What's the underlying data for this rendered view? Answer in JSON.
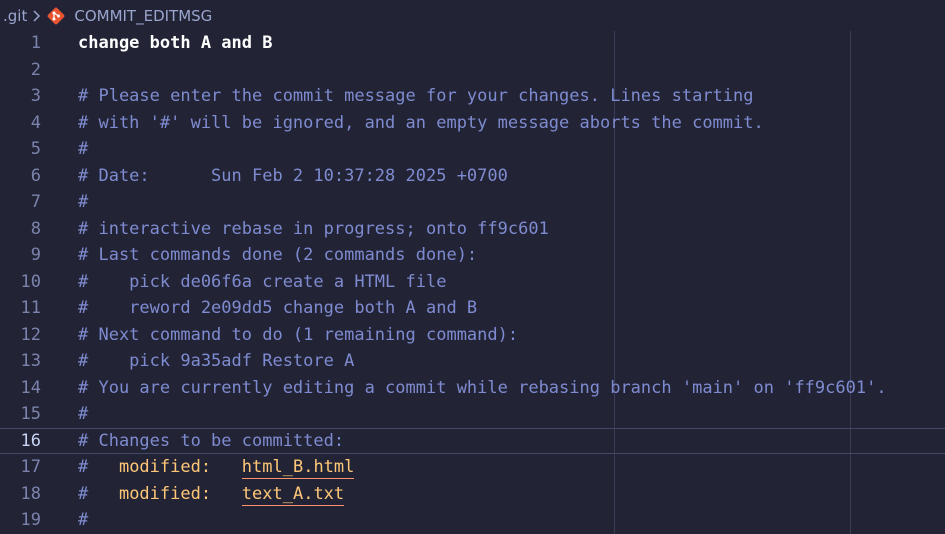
{
  "breadcrumb": {
    "folder": ".git",
    "file": "COMMIT_EDITMSG",
    "file_icon": "git-icon",
    "separator_icon": "chevron-right-icon"
  },
  "colors": {
    "background": "#222436",
    "comment": "#7f8bd0",
    "highlight": "#ffc777",
    "git_icon": "#e8542f"
  },
  "editor": {
    "current_line": "16",
    "lines": [
      {
        "num": "1",
        "text": "change both A and B"
      },
      {
        "num": "2",
        "text": ""
      },
      {
        "num": "3",
        "text": "# Please enter the commit message for your changes. Lines starting"
      },
      {
        "num": "4",
        "text": "# with '#' will be ignored, and an empty message aborts the commit."
      },
      {
        "num": "5",
        "text": "#"
      },
      {
        "num": "6",
        "text": "# Date:      Sun Feb 2 10:37:28 2025 +0700"
      },
      {
        "num": "7",
        "text": "#"
      },
      {
        "num": "8",
        "text": "# interactive rebase in progress; onto ff9c601"
      },
      {
        "num": "9",
        "text": "# Last commands done (2 commands done):"
      },
      {
        "num": "10",
        "text": "#    pick de06f6a create a HTML file"
      },
      {
        "num": "11",
        "text": "#    reword 2e09dd5 change both A and B"
      },
      {
        "num": "12",
        "text": "# Next command to do (1 remaining command):"
      },
      {
        "num": "13",
        "text": "#    pick 9a35adf Restore A"
      },
      {
        "num": "14",
        "text": "# You are currently editing a commit while rebasing branch 'main' on 'ff9c601'."
      },
      {
        "num": "15",
        "text": "#"
      },
      {
        "num": "16",
        "text": "# Changes to be committed:"
      },
      {
        "num": "17",
        "prefix": "#   ",
        "keyword": "modified:",
        "gap": "   ",
        "file": "html_B.html"
      },
      {
        "num": "18",
        "prefix": "#   ",
        "keyword": "modified:",
        "gap": "   ",
        "file": "text_A.txt"
      },
      {
        "num": "19",
        "text": "#"
      }
    ]
  }
}
